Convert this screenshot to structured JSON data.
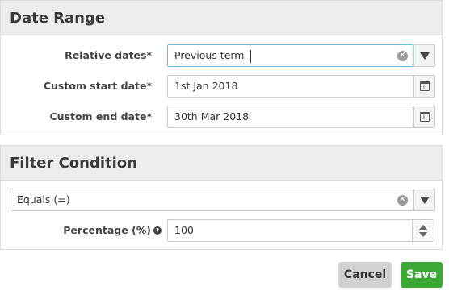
{
  "date_range": {
    "title": "Date Range",
    "relative_dates": {
      "label": "Relative dates*",
      "value": "Previous term"
    },
    "custom_start": {
      "label": "Custom start date*",
      "value": "1st Jan 2018"
    },
    "custom_end": {
      "label": "Custom end date*",
      "value": "30th Mar 2018"
    }
  },
  "filter_condition": {
    "title": "Filter Condition",
    "condition": {
      "value": "Equals (=)"
    },
    "percentage": {
      "label": "Percentage (%)",
      "value": "100"
    }
  },
  "icons": {
    "clear": "clear-icon",
    "dropdown": "chevron-down-icon",
    "calendar": "calendar-icon",
    "help": "help-icon",
    "stepper": "stepper-icon"
  },
  "colors": {
    "header_bg": "#ededed",
    "focus_border": "#66bfe0",
    "save_bg": "#3aaa35",
    "cancel_bg": "#d2d2d2"
  },
  "actions": {
    "cancel_label": "Cancel",
    "save_label": "Save"
  }
}
